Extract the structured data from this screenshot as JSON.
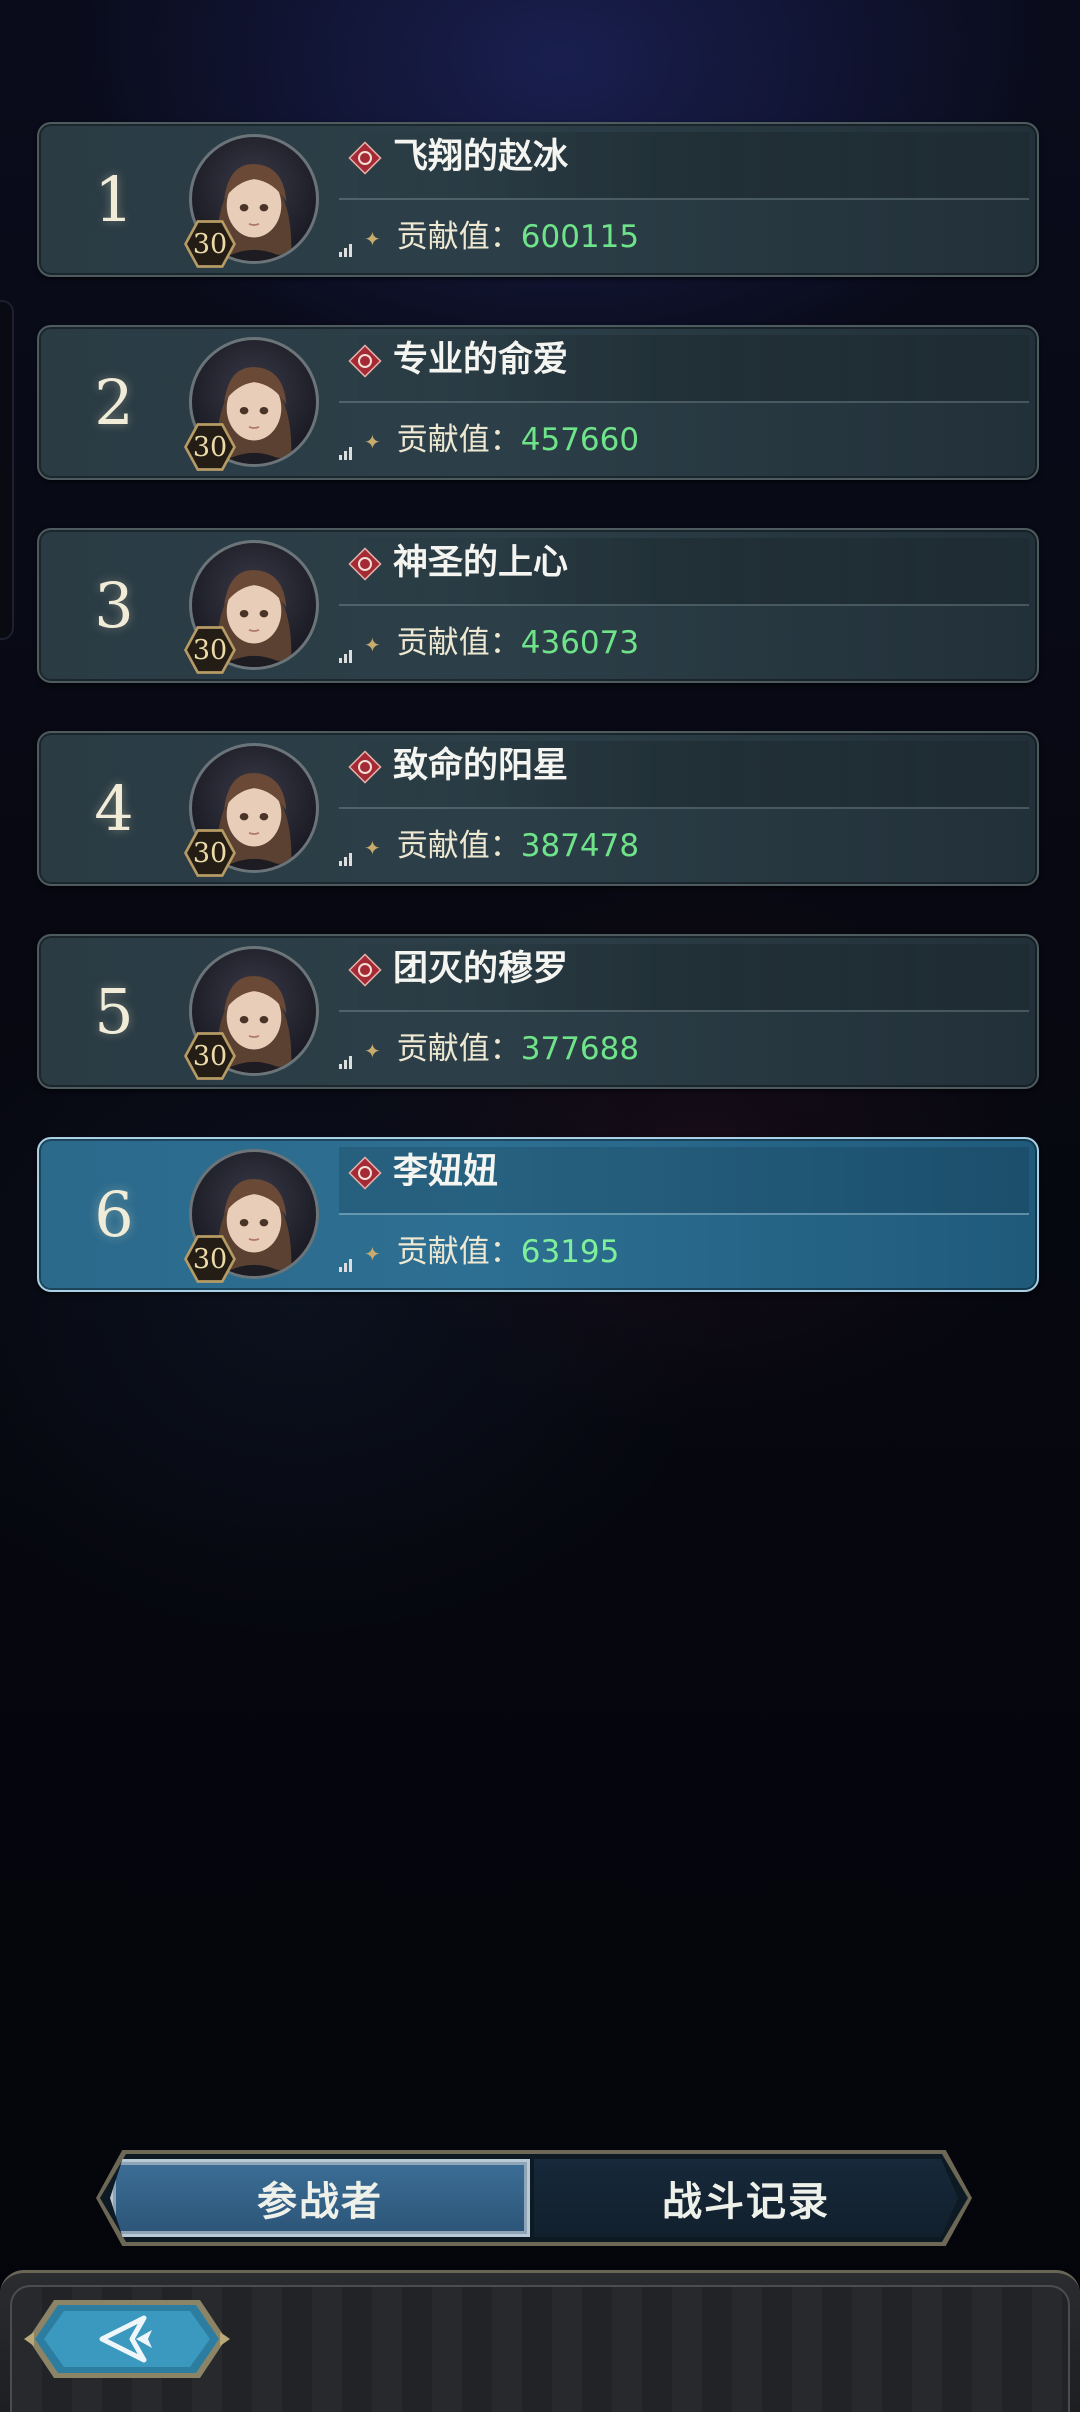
{
  "contribution_label": "贡献值：",
  "players": [
    {
      "rank": "1",
      "name": "飞翔的赵冰",
      "level": "30",
      "contribution": "600115",
      "is_self": false
    },
    {
      "rank": "2",
      "name": "专业的俞爱",
      "level": "30",
      "contribution": "457660",
      "is_self": false
    },
    {
      "rank": "3",
      "name": "神圣的上心",
      "level": "30",
      "contribution": "436073",
      "is_self": false
    },
    {
      "rank": "4",
      "name": "致命的阳星",
      "level": "30",
      "contribution": "387478",
      "is_self": false
    },
    {
      "rank": "5",
      "name": "团灭的穆罗",
      "level": "30",
      "contribution": "377688",
      "is_self": false
    },
    {
      "rank": "6",
      "name": "李妞妞",
      "level": "30",
      "contribution": "63195",
      "is_self": true
    }
  ],
  "tabs": {
    "participants": "参战者",
    "battle_log": "战斗记录"
  },
  "icons": {
    "faction": "faction-emblem-icon",
    "back": "back-arrow-icon",
    "star": "star-bullet-icon",
    "signal": "signal-icon"
  },
  "colors": {
    "row_bg": "#2c3f48",
    "self_row_bg": "#2d6f92",
    "contribution_value": "#6fe38a",
    "faction_red": "#a42a35"
  }
}
